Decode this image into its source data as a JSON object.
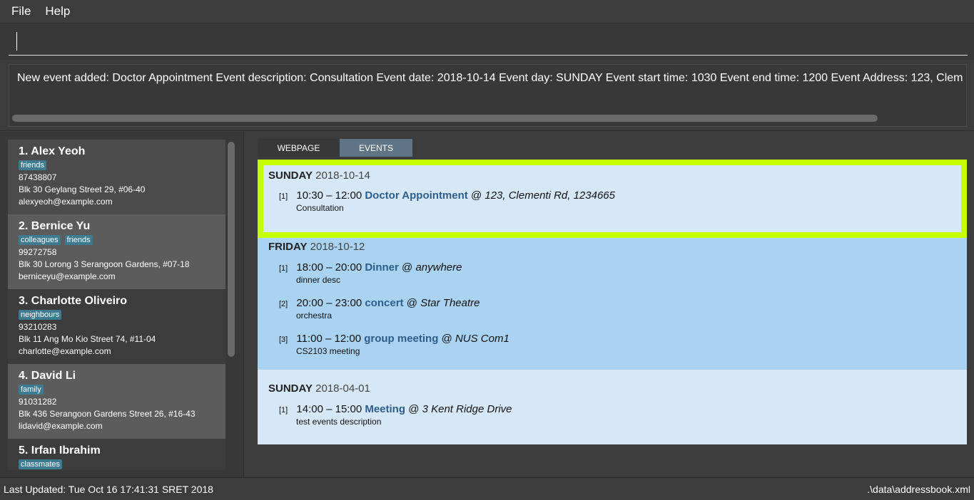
{
  "menu": {
    "file": "File",
    "help": "Help"
  },
  "command": {
    "value": ""
  },
  "result": {
    "text": "New event added: Doctor Appointment Event description: Consultation Event date: 2018-10-14 Event day: SUNDAY Event start time: 1030 Event end time: 1200 Event Address: 123, Clem"
  },
  "persons": [
    {
      "index": "1.",
      "name": "Alex Yeoh",
      "tags": [
        "friends"
      ],
      "phone": "87438807",
      "address": "Blk 30 Geylang Street 29, #06-40",
      "email": "alexyeoh@example.com"
    },
    {
      "index": "2.",
      "name": "Bernice Yu",
      "tags": [
        "colleagues",
        "friends"
      ],
      "phone": "99272758",
      "address": "Blk 30 Lorong 3 Serangoon Gardens, #07-18",
      "email": "berniceyu@example.com"
    },
    {
      "index": "3.",
      "name": "Charlotte Oliveiro",
      "tags": [
        "neighbours"
      ],
      "phone": "93210283",
      "address": "Blk 11 Ang Mo Kio Street 74, #11-04",
      "email": "charlotte@example.com"
    },
    {
      "index": "4.",
      "name": "David Li",
      "tags": [
        "family"
      ],
      "phone": "91031282",
      "address": "Blk 436 Serangoon Gardens Street 26, #16-43",
      "email": "lidavid@example.com"
    },
    {
      "index": "5.",
      "name": "Irfan Ibrahim",
      "tags": [
        "classmates"
      ],
      "phone": "",
      "address": "",
      "email": ""
    }
  ],
  "tabs": {
    "webpage": "WEBPAGE",
    "events": "EVENTS"
  },
  "event_groups": [
    {
      "day": "SUNDAY",
      "date": "2018-10-14",
      "events": [
        {
          "idx": "[1]",
          "time": "10:30 – 12:00",
          "title": "Doctor Appointment",
          "at": "@",
          "address": "123, Clementi Rd, 1234665",
          "desc": "Consultation"
        }
      ]
    },
    {
      "day": "FRIDAY",
      "date": "2018-10-12",
      "events": [
        {
          "idx": "[1]",
          "time": "18:00 – 20:00",
          "title": "Dinner",
          "at": "@",
          "address": "anywhere",
          "desc": "dinner desc"
        },
        {
          "idx": "[2]",
          "time": "20:00 – 23:00",
          "title": "concert",
          "at": "@",
          "address": "Star Theatre",
          "desc": "orchestra"
        },
        {
          "idx": "[3]",
          "time": "11:00 – 12:00",
          "title": "group meeting",
          "at": "@",
          "address": "NUS Com1",
          "desc": "CS2103 meeting"
        }
      ]
    },
    {
      "day": "SUNDAY",
      "date": "2018-04-01",
      "events": [
        {
          "idx": "[1]",
          "time": "14:00 – 15:00",
          "title": "Meeting",
          "at": "@",
          "address": "3 Kent Ridge Drive",
          "desc": "test events description"
        }
      ]
    }
  ],
  "status": {
    "last_updated": "Last Updated: Tue Oct 16 17:41:31 SRET 2018",
    "file_path": ".\\data\\addressbook.xml"
  },
  "colors": {
    "background": "#3c3c3c",
    "tag": "#3e7b91",
    "highlight": "#c6ff00",
    "event_light": "#d6e8f7",
    "event_dark": "#a9d3f0",
    "event_title": "#2f5d8a"
  }
}
